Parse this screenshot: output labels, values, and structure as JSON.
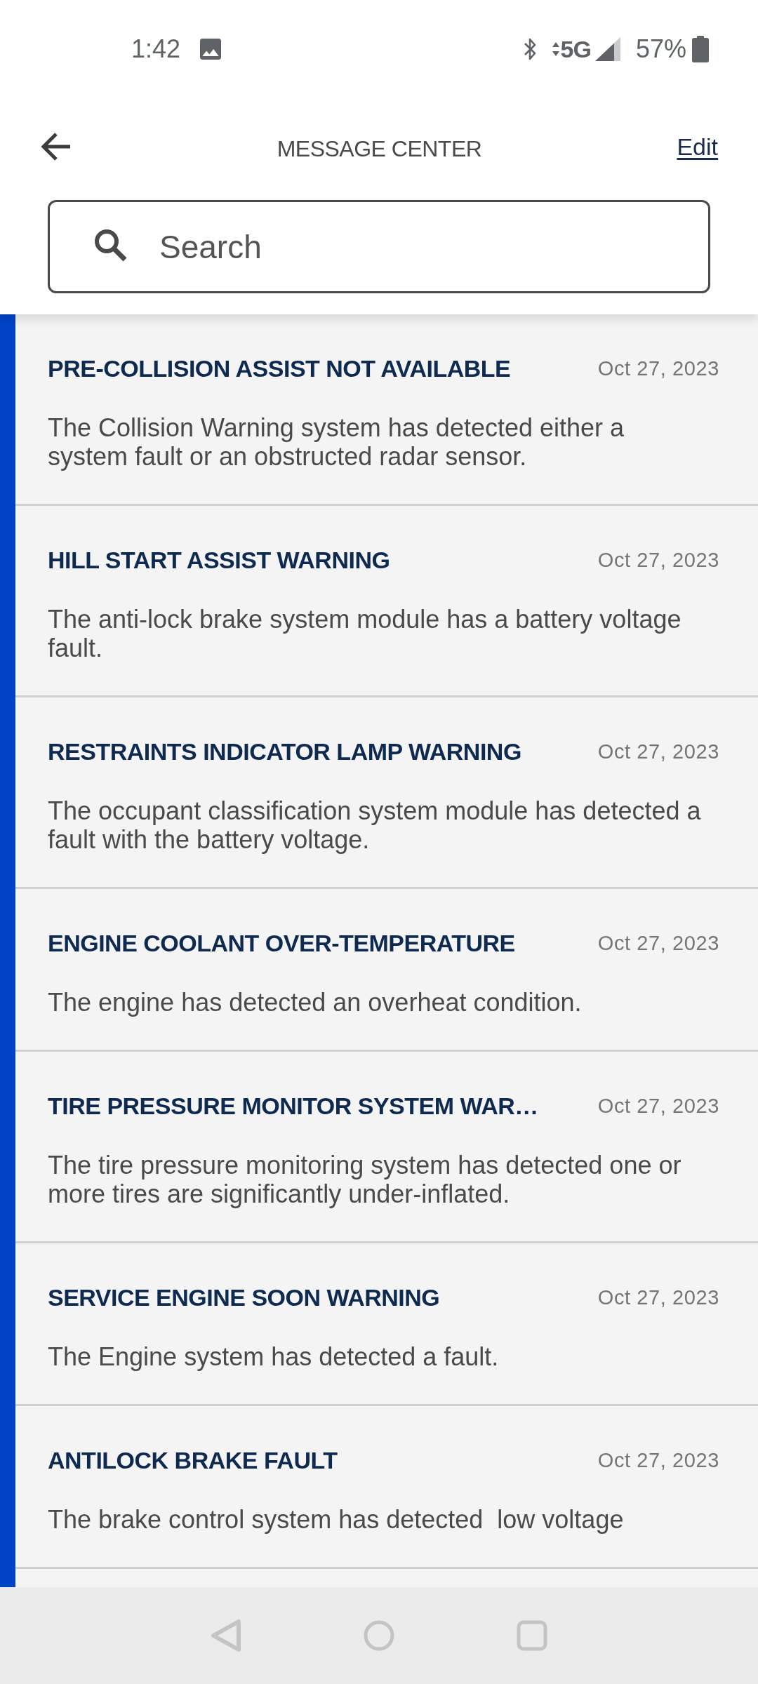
{
  "status_bar": {
    "time": "1:42",
    "network": "5G",
    "battery": "57%"
  },
  "header": {
    "title": "MESSAGE CENTER",
    "edit": "Edit"
  },
  "search": {
    "placeholder": "Search"
  },
  "messages": [
    {
      "title": "PRE-COLLISION ASSIST NOT AVAILABLE",
      "date": "Oct 27, 2023",
      "body": "The Collision Warning system has detected either a system fault or an obstructed radar sensor.",
      "unread": true
    },
    {
      "title": "HILL START ASSIST WARNING",
      "date": "Oct 27, 2023",
      "body": "The anti-lock brake system module has a battery voltage fault.",
      "unread": true
    },
    {
      "title": "RESTRAINTS INDICATOR LAMP WARNING",
      "date": "Oct 27, 2023",
      "body": "The occupant classification system module has detected a fault with the battery voltage.",
      "unread": true
    },
    {
      "title": "ENGINE COOLANT OVER-TEMPERATURE",
      "date": "Oct 27, 2023",
      "body": "The engine has detected an overheat condition.",
      "unread": true
    },
    {
      "title": "TIRE PRESSURE MONITOR SYSTEM WAR…",
      "date": "Oct 27, 2023",
      "body": "The tire pressure monitoring system has detected one or more tires are significantly under-inflated.",
      "unread": true
    },
    {
      "title": "SERVICE ENGINE SOON WARNING",
      "date": "Oct 27, 2023",
      "body": "The Engine system has detected a fault.",
      "unread": true
    },
    {
      "title": "ANTILOCK BRAKE FAULT",
      "date": "Oct 27, 2023",
      "body": "The brake control system has detected  low voltage",
      "unread": true
    }
  ],
  "partial_row": {
    "unread": true
  }
}
